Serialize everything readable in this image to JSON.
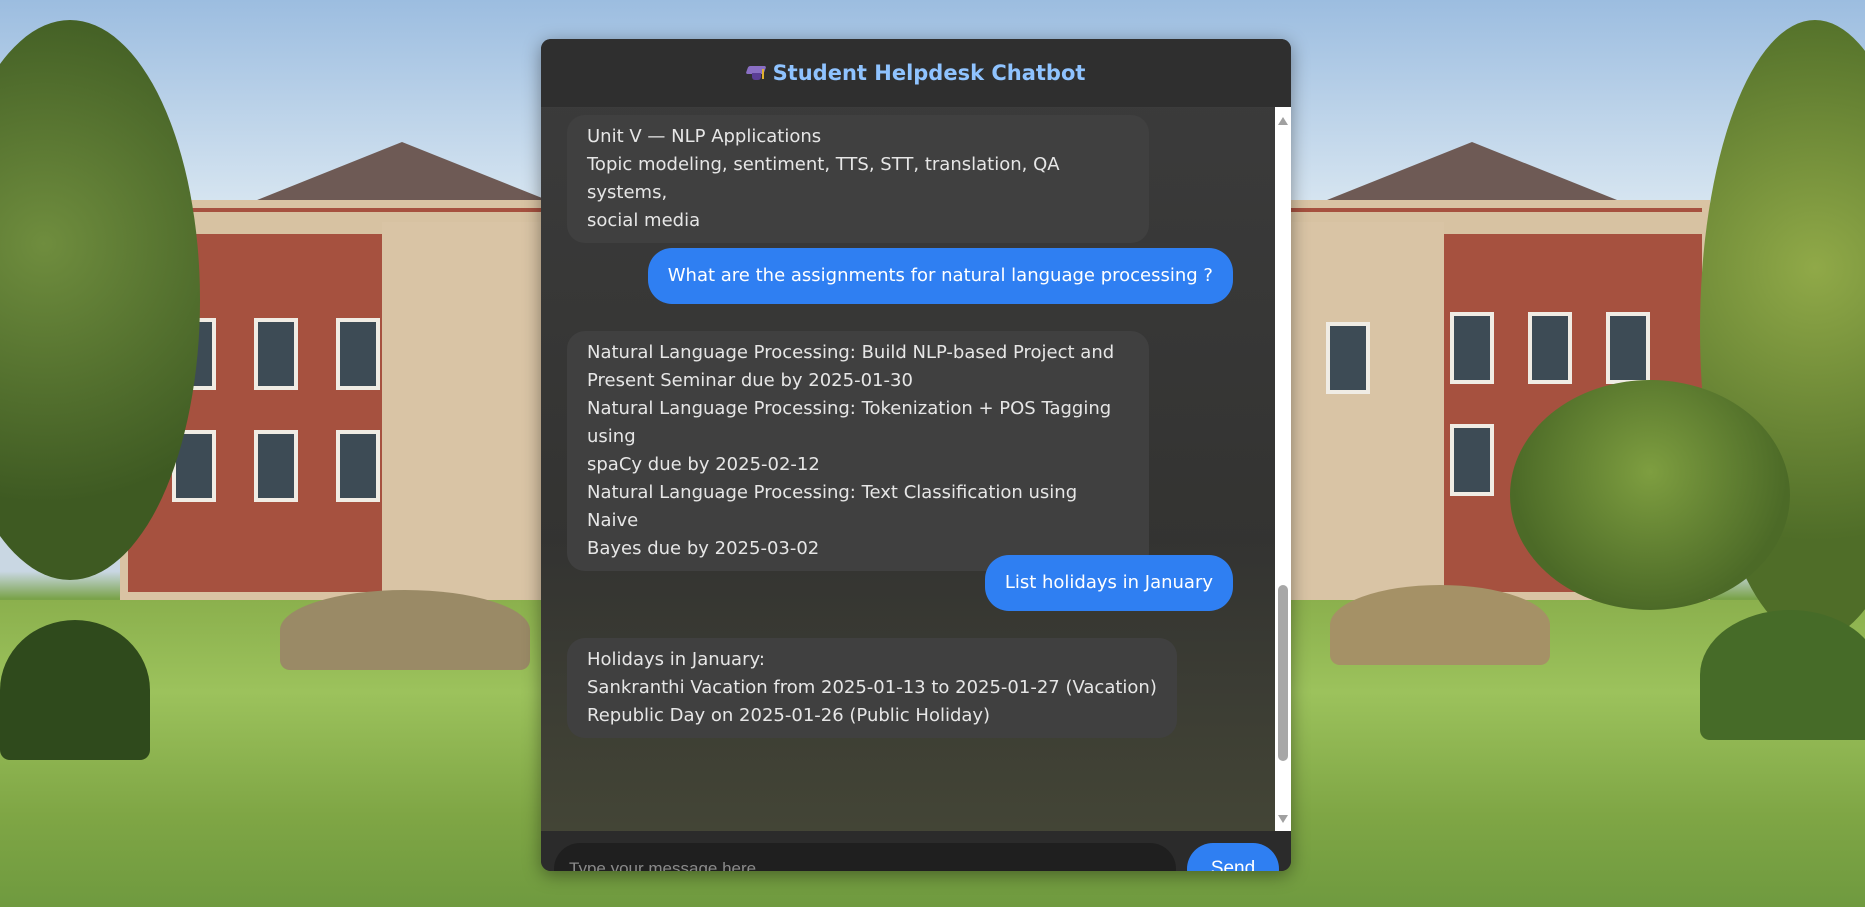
{
  "header": {
    "icon": "graduation-cap-icon",
    "title": "Student Helpdesk Chatbot"
  },
  "messages": [
    {
      "role": "bot",
      "text": "Unit V — NLP Applications\nTopic modeling, sentiment, TTS, STT, translation, QA systems,\nsocial media"
    },
    {
      "role": "user",
      "text": "What are the assignments for natural language processing ?"
    },
    {
      "role": "bot",
      "text": "Natural Language Processing: Build NLP-based Project and\nPresent Seminar due by 2025-01-30\nNatural Language Processing: Tokenization + POS Tagging using\nspaCy due by 2025-02-12\nNatural Language Processing: Text Classification using Naive\nBayes due by 2025-03-02"
    },
    {
      "role": "user",
      "text": "List holidays in January"
    },
    {
      "role": "bot",
      "text": "Holidays in January:\nSankranthi Vacation from 2025-01-13 to 2025-01-27 (Vacation)\nRepublic Day on 2025-01-26 (Public Holiday)"
    }
  ],
  "composer": {
    "placeholder": "Type your message here...",
    "send_label": "Send"
  },
  "colors": {
    "accent": "#2f7ff2",
    "title": "#8fc3ff",
    "panel": "#2b2b2b"
  }
}
